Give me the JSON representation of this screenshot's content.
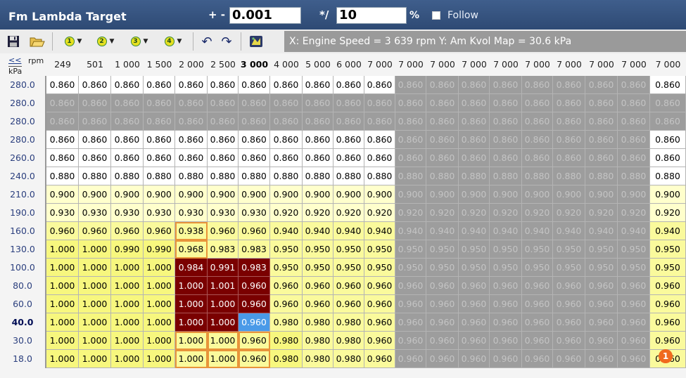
{
  "header": {
    "title": "Fm Lambda Target",
    "increment_label": "+ -",
    "increment_value": "0.001",
    "multiply_label": "*/",
    "multiply_value": "10",
    "percent_label": "%",
    "follow_label": "Follow",
    "follow_checked": false
  },
  "toolbar": {
    "icons": [
      "save-icon",
      "open-folder-icon",
      "graph-1-icon",
      "graph-2-icon",
      "graph-3-icon",
      "graph-4-icon",
      "undo-icon",
      "redo-icon",
      "map-view-icon"
    ],
    "graph_labels": [
      "1",
      "2",
      "3",
      "4"
    ],
    "dropdown_glyph": "▼",
    "undo_glyph": "↶",
    "redo_glyph": "↷",
    "status_text": "X: Engine Speed = 3 639 rpm   Y: Am Kvol Map = 30.6 kPa"
  },
  "table": {
    "corner_button": "<<",
    "x_unit": "rpm",
    "y_unit": "kPa",
    "columns": [
      "249",
      "501",
      "1 000",
      "1 500",
      "2 000",
      "2 500",
      "3 000",
      "4 000",
      "5 000",
      "6 000",
      "7 000",
      "7 000",
      "7 000",
      "7 000",
      "7 000",
      "7 000",
      "7 000",
      "7 000",
      "7 000",
      "7 000"
    ],
    "highlight_column": 6,
    "highlight_row": 13,
    "rows": [
      {
        "label": "280.0",
        "values": [
          "0.860",
          "0.860",
          "0.860",
          "0.860",
          "0.860",
          "0.860",
          "0.860",
          "0.860",
          "0.860",
          "0.860",
          "0.860",
          "0.860",
          "0.860",
          "0.860",
          "0.860",
          "0.860",
          "0.860",
          "0.860",
          "0.860",
          "0.860"
        ],
        "styles": "wwwwwwwwwwwgggggggggw"
      },
      {
        "label": "280.0",
        "values": [
          "0.860",
          "0.860",
          "0.860",
          "0.860",
          "0.860",
          "0.860",
          "0.860",
          "0.860",
          "0.860",
          "0.860",
          "0.860",
          "0.860",
          "0.860",
          "0.860",
          "0.860",
          "0.860",
          "0.860",
          "0.860",
          "0.860",
          "0.860"
        ],
        "styles": "gggggggggggggggggggg"
      },
      {
        "label": "280.0",
        "values": [
          "0.860",
          "0.860",
          "0.860",
          "0.860",
          "0.860",
          "0.860",
          "0.860",
          "0.860",
          "0.860",
          "0.860",
          "0.860",
          "0.860",
          "0.860",
          "0.860",
          "0.860",
          "0.860",
          "0.860",
          "0.860",
          "0.860",
          "0.860"
        ],
        "styles": "gggggggggggggggggggg"
      },
      {
        "label": "280.0",
        "values": [
          "0.860",
          "0.860",
          "0.860",
          "0.860",
          "0.860",
          "0.860",
          "0.860",
          "0.860",
          "0.860",
          "0.860",
          "0.860",
          "0.860",
          "0.860",
          "0.860",
          "0.860",
          "0.860",
          "0.860",
          "0.860",
          "0.860",
          "0.860"
        ],
        "styles": "wwwwwwwwwwwgggggggggw"
      },
      {
        "label": "260.0",
        "values": [
          "0.860",
          "0.860",
          "0.860",
          "0.860",
          "0.860",
          "0.860",
          "0.860",
          "0.860",
          "0.860",
          "0.860",
          "0.860",
          "0.860",
          "0.860",
          "0.860",
          "0.860",
          "0.860",
          "0.860",
          "0.860",
          "0.860",
          "0.860"
        ],
        "styles": "wwwwwwwwwwwgggggggggw"
      },
      {
        "label": "240.0",
        "values": [
          "0.880",
          "0.880",
          "0.880",
          "0.880",
          "0.880",
          "0.880",
          "0.880",
          "0.880",
          "0.880",
          "0.880",
          "0.880",
          "0.880",
          "0.880",
          "0.880",
          "0.880",
          "0.880",
          "0.880",
          "0.880",
          "0.880",
          "0.880"
        ],
        "styles": "wwwwwwwwwwwgggggggggw"
      },
      {
        "label": "210.0",
        "values": [
          "0.900",
          "0.900",
          "0.900",
          "0.900",
          "0.900",
          "0.900",
          "0.900",
          "0.900",
          "0.900",
          "0.900",
          "0.900",
          "0.900",
          "0.900",
          "0.900",
          "0.900",
          "0.900",
          "0.900",
          "0.900",
          "0.900",
          "0.900"
        ],
        "styles": "lllllllllllgggggggggl"
      },
      {
        "label": "190.0",
        "values": [
          "0.930",
          "0.930",
          "0.930",
          "0.930",
          "0.930",
          "0.930",
          "0.930",
          "0.920",
          "0.920",
          "0.920",
          "0.920",
          "0.920",
          "0.920",
          "0.920",
          "0.920",
          "0.920",
          "0.920",
          "0.920",
          "0.920",
          "0.920"
        ],
        "styles": "lllllllllllgggggggggl"
      },
      {
        "label": "160.0",
        "values": [
          "0.960",
          "0.960",
          "0.960",
          "0.960",
          "0.938",
          "0.960",
          "0.960",
          "0.940",
          "0.940",
          "0.940",
          "0.940",
          "0.940",
          "0.940",
          "0.940",
          "0.940",
          "0.940",
          "0.940",
          "0.940",
          "0.940",
          "0.940"
        ],
        "styles": "mmmmommmmmmgggggggggm"
      },
      {
        "label": "130.0",
        "values": [
          "1.000",
          "1.000",
          "0.990",
          "0.990",
          "0.968",
          "0.983",
          "0.983",
          "0.950",
          "0.950",
          "0.950",
          "0.950",
          "0.950",
          "0.950",
          "0.950",
          "0.950",
          "0.950",
          "0.950",
          "0.950",
          "0.950",
          "0.950"
        ],
        "styles": "yyyyommmmmmgggggggggm"
      },
      {
        "label": "100.0",
        "values": [
          "1.000",
          "1.000",
          "1.000",
          "1.000",
          "0.984",
          "0.991",
          "0.983",
          "0.950",
          "0.950",
          "0.950",
          "0.950",
          "0.950",
          "0.950",
          "0.950",
          "0.950",
          "0.950",
          "0.950",
          "0.950",
          "0.950",
          "0.950"
        ],
        "styles": "yyyyrrrmmmmgggggggggm"
      },
      {
        "label": "80.0",
        "values": [
          "1.000",
          "1.000",
          "1.000",
          "1.000",
          "1.000",
          "1.001",
          "0.960",
          "0.960",
          "0.960",
          "0.960",
          "0.960",
          "0.960",
          "0.960",
          "0.960",
          "0.960",
          "0.960",
          "0.960",
          "0.960",
          "0.960",
          "0.960"
        ],
        "styles": "yyyyrrrmmmmgggggggggm"
      },
      {
        "label": "60.0",
        "values": [
          "1.000",
          "1.000",
          "1.000",
          "1.000",
          "1.000",
          "1.000",
          "0.960",
          "0.960",
          "0.960",
          "0.960",
          "0.960",
          "0.960",
          "0.960",
          "0.960",
          "0.960",
          "0.960",
          "0.960",
          "0.960",
          "0.960",
          "0.960"
        ],
        "styles": "yyyyrrrmmmmgggggggggm"
      },
      {
        "label": "40.0",
        "values": [
          "1.000",
          "1.000",
          "1.000",
          "1.000",
          "1.000",
          "1.000",
          "0.960",
          "0.980",
          "0.980",
          "0.980",
          "0.960",
          "0.960",
          "0.960",
          "0.960",
          "0.960",
          "0.960",
          "0.960",
          "0.960",
          "0.960",
          "0.960"
        ],
        "styles": "yyyyrrsmmmmgggggggggm"
      },
      {
        "label": "30.0",
        "values": [
          "1.000",
          "1.000",
          "1.000",
          "1.000",
          "1.000",
          "1.000",
          "0.960",
          "0.980",
          "0.980",
          "0.980",
          "0.960",
          "0.960",
          "0.960",
          "0.960",
          "0.960",
          "0.960",
          "0.960",
          "0.960",
          "0.960",
          "0.960"
        ],
        "styles": "yyyyoooymmmgggggggggm"
      },
      {
        "label": "18.0",
        "values": [
          "1.000",
          "1.000",
          "1.000",
          "1.000",
          "1.000",
          "1.000",
          "0.960",
          "0.980",
          "0.980",
          "0.980",
          "0.960",
          "0.960",
          "0.960",
          "0.960",
          "0.960",
          "0.960",
          "0.960",
          "0.960",
          "0.960",
          "0.960"
        ],
        "styles": "yyyyoooymmmgggggggggm"
      }
    ],
    "notification_badge": "1"
  },
  "colors": {
    "title_bar": "#3f5e8c",
    "status_bar": "#9a9a9a",
    "gray_cell": "#9d9d9d",
    "yellow_cell": "#f7f77e",
    "red_cell": "#7a0000",
    "selected_cell": "#4a9ae8",
    "orange_outline": "#e8943a"
  }
}
